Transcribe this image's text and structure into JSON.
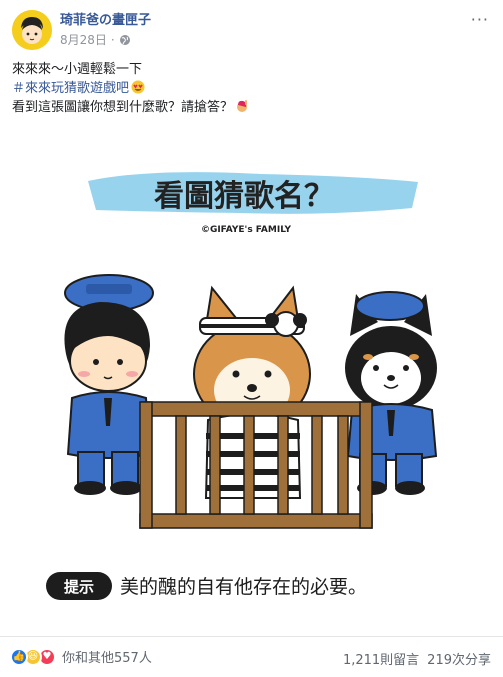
{
  "post": {
    "author": "琦菲爸の畫匣子",
    "date": "8月28日",
    "separator": "·",
    "privacy_icon": "globe-icon",
    "more_label": "···",
    "lines": {
      "line1": "來來來～小週輕鬆一下",
      "hashtag": "＃來來玩猜歌遊戲吧",
      "line3": "看到這張圖讓你想到什麼歌？請搶答？"
    }
  },
  "image": {
    "title": "看圖猜歌名？",
    "copyright": "©GIFAYE's FAMILY",
    "hint_label": "提示",
    "hint_text": "美的醜的自有他存在的必要。",
    "colors": {
      "banner": "#7ec8e8",
      "uniform": "#3b6fc6",
      "cage": "#a0703a",
      "shiba": "#d9964a"
    }
  },
  "stats": {
    "reaction_icons": [
      "like-icon",
      "haha-icon",
      "love-icon"
    ],
    "reactions_text": "你和其他557人",
    "comments": "1,211則留言",
    "shares": "219次分享"
  }
}
